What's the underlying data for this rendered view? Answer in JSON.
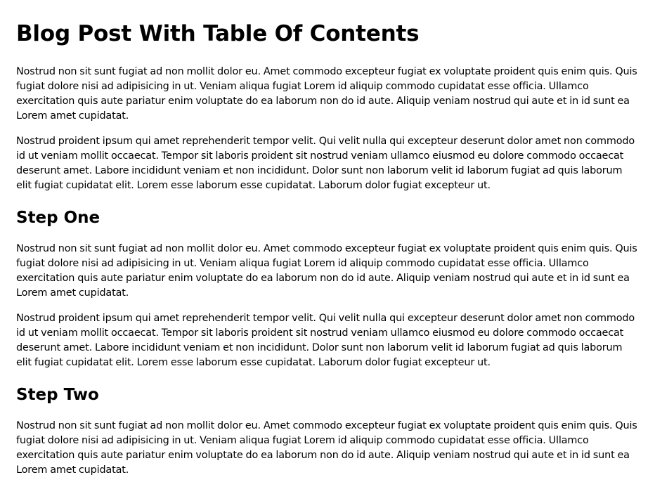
{
  "article": {
    "title": "Blog Post With Table Of Contents",
    "intro": [
      "Nostrud non sit sunt fugiat ad non mollit dolor eu. Amet commodo excepteur fugiat ex voluptate proident quis enim quis. Quis fugiat dolore nisi ad adipisicing in ut. Veniam aliqua fugiat Lorem id aliquip commodo cupidatat esse officia. Ullamco exercitation quis aute pariatur enim voluptate do ea laborum non do id aute. Aliquip veniam nostrud qui aute et in id sunt ea Lorem amet cupidatat.",
      "Nostrud proident ipsum qui amet reprehenderit tempor velit. Qui velit nulla qui excepteur deserunt dolor amet non commodo id ut veniam mollit occaecat. Tempor sit laboris proident sit nostrud veniam ullamco eiusmod eu dolore commodo occaecat deserunt amet. Labore incididunt veniam et non incididunt. Dolor sunt non laborum velit id laborum fugiat ad quis laborum elit fugiat cupidatat elit. Lorem esse laborum esse cupidatat. Laborum dolor fugiat excepteur ut."
    ],
    "sections": [
      {
        "heading": "Step One",
        "paragraphs": [
          "Nostrud non sit sunt fugiat ad non mollit dolor eu. Amet commodo excepteur fugiat ex voluptate proident quis enim quis. Quis fugiat dolore nisi ad adipisicing in ut. Veniam aliqua fugiat Lorem id aliquip commodo cupidatat esse officia. Ullamco exercitation quis aute pariatur enim voluptate do ea laborum non do id aute. Aliquip veniam nostrud qui aute et in id sunt ea Lorem amet cupidatat.",
          "Nostrud proident ipsum qui amet reprehenderit tempor velit. Qui velit nulla qui excepteur deserunt dolor amet non commodo id ut veniam mollit occaecat. Tempor sit laboris proident sit nostrud veniam ullamco eiusmod eu dolore commodo occaecat deserunt amet. Labore incididunt veniam et non incididunt. Dolor sunt non laborum velit id laborum fugiat ad quis laborum elit fugiat cupidatat elit. Lorem esse laborum esse cupidatat. Laborum dolor fugiat excepteur ut."
        ]
      },
      {
        "heading": "Step Two",
        "paragraphs": [
          "Nostrud non sit sunt fugiat ad non mollit dolor eu. Amet commodo excepteur fugiat ex voluptate proident quis enim quis. Quis fugiat dolore nisi ad adipisicing in ut. Veniam aliqua fugiat Lorem id aliquip commodo cupidatat esse officia. Ullamco exercitation quis aute pariatur enim voluptate do ea laborum non do id aute. Aliquip veniam nostrud qui aute et in id sunt ea Lorem amet cupidatat."
        ]
      }
    ]
  }
}
